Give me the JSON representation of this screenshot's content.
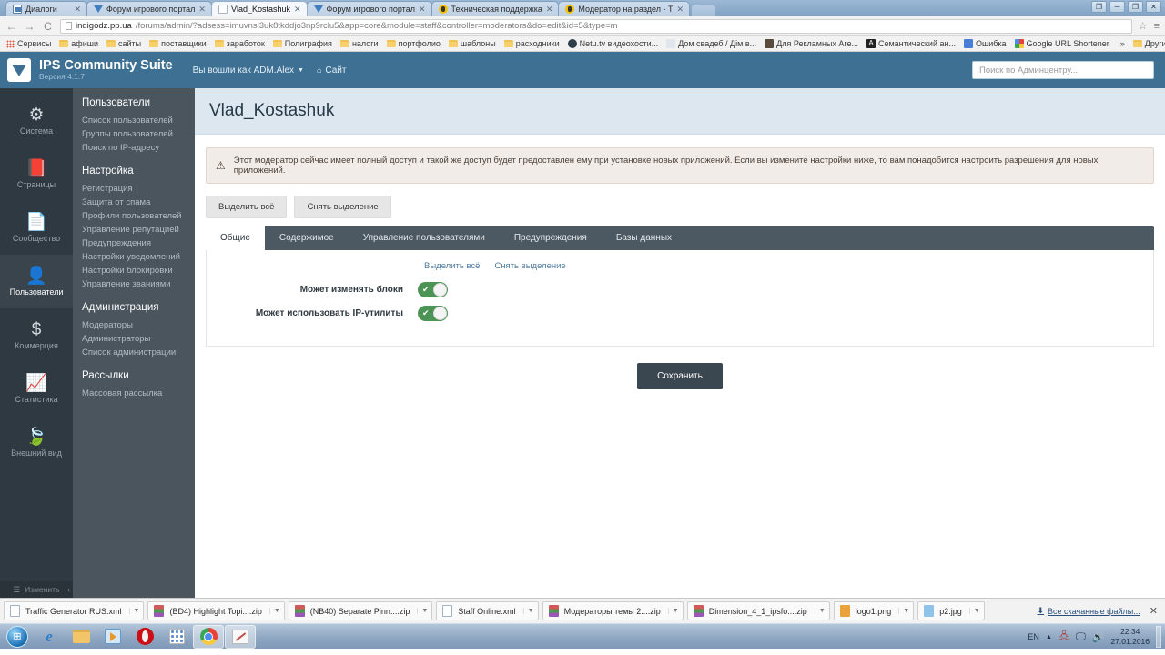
{
  "browser": {
    "tabs": [
      {
        "title": "Диалоги",
        "icon": "dialog-icon",
        "active": false
      },
      {
        "title": "Форум игрового портал",
        "icon": "forum-icon",
        "active": false
      },
      {
        "title": "Vlad_Kostashuk",
        "icon": "document-icon",
        "active": true
      },
      {
        "title": "Форум игрового портал",
        "icon": "forum-icon",
        "active": false
      },
      {
        "title": "Техническая поддержка",
        "icon": "support-icon",
        "active": false
      },
      {
        "title": "Модератор на раздел - Т",
        "icon": "support-icon",
        "active": false
      }
    ],
    "close_label": "✕",
    "window_buttons": [
      "❐",
      "─",
      "❐",
      "✕"
    ],
    "nav": {
      "back": "←",
      "forward": "→",
      "reload": "C",
      "star": "☆",
      "menu": "≡"
    },
    "url": {
      "host": "indigodz.pp.ua",
      "path": "/forums/admin/?adsess=imuvnsl3uk8tkddjo3np9rclu5&app=core&module=staff&controller=moderators&do=edit&id=5&type=m"
    },
    "bookmarks": [
      {
        "label": "Сервисы",
        "icon": "apps-grid-icon"
      },
      {
        "label": "афиши",
        "icon": "folder-icon"
      },
      {
        "label": "сайты",
        "icon": "folder-icon"
      },
      {
        "label": "поставщики",
        "icon": "folder-icon"
      },
      {
        "label": "заработок",
        "icon": "folder-icon"
      },
      {
        "label": "Полиграфия",
        "icon": "folder-icon"
      },
      {
        "label": "налоги",
        "icon": "folder-icon"
      },
      {
        "label": "портфолио",
        "icon": "folder-icon"
      },
      {
        "label": "шаблоны",
        "icon": "folder-icon"
      },
      {
        "label": "расходники",
        "icon": "folder-icon"
      },
      {
        "label": "Netu.tv видеохости...",
        "icon": "netu-icon"
      },
      {
        "label": "Дом свадеб / Дім в...",
        "icon": "site-icon"
      },
      {
        "label": "Для Рекламных Аге...",
        "icon": "agency-icon"
      },
      {
        "label": "Семантический ан...",
        "icon": "letter-a-icon"
      },
      {
        "label": "Ошибка",
        "icon": "error-icon"
      },
      {
        "label": "Google URL Shortener",
        "icon": "google-icon"
      }
    ],
    "bookmarks_overflow": "»",
    "other_bookmarks": "Другие закладки"
  },
  "ips": {
    "brand_name": "IPS Community Suite",
    "version": "Версия 4.1.7",
    "user_menu": "Вы вошли как ADM.Alex",
    "site_link": "Сайт",
    "search_placeholder": "Поиск по Админцентру...",
    "rail": [
      {
        "label": "Система",
        "icon": "gears-icon",
        "active": false
      },
      {
        "label": "Страницы",
        "icon": "book-icon",
        "active": false
      },
      {
        "label": "Сообщество",
        "icon": "document-icon",
        "active": false
      },
      {
        "label": "Пользователи",
        "icon": "user-icon",
        "active": true
      },
      {
        "label": "Коммерция",
        "icon": "dollar-icon",
        "active": false
      },
      {
        "label": "Статистика",
        "icon": "chart-icon",
        "active": false
      },
      {
        "label": "Внешний вид",
        "icon": "leaf-icon",
        "active": false
      }
    ],
    "rail_edit": "Изменить",
    "menu_groups": [
      {
        "heading": "Пользователи",
        "items": [
          "Список пользователей",
          "Группы пользователей",
          "Поиск по IP-адресу"
        ]
      },
      {
        "heading": "Настройка",
        "items": [
          "Регистрация",
          "Защита от спама",
          "Профили пользователей",
          "Управление репутацией",
          "Предупреждения",
          "Настройки уведомлений",
          "Настройки блокировки",
          "Управление званиями"
        ]
      },
      {
        "heading": "Администрация",
        "items": [
          "Модераторы",
          "Администраторы",
          "Список администрации"
        ]
      },
      {
        "heading": "Рассылки",
        "items": [
          "Массовая рассылка"
        ]
      }
    ]
  },
  "page": {
    "title": "Vlad_Kostashuk",
    "alert_icon": "warning-icon",
    "alert_text": "Этот модератор сейчас имеет полный доступ и такой же доступ будет предоставлен ему при установке новых приложений. Если вы измените настройки ниже, то вам понадобится настроить разрешения для новых приложений.",
    "top_buttons": [
      {
        "label": "Выделить всё"
      },
      {
        "label": "Снять выделение"
      }
    ],
    "tabs": [
      {
        "label": "Общие",
        "active": true
      },
      {
        "label": "Содержимое",
        "active": false
      },
      {
        "label": "Управление пользователями",
        "active": false
      },
      {
        "label": "Предупреждения",
        "active": false
      },
      {
        "label": "Базы данных",
        "active": false
      }
    ],
    "panel_links": [
      {
        "label": "Выделить всё"
      },
      {
        "label": "Снять выделение"
      }
    ],
    "fields": [
      {
        "label": "Может изменять блоки",
        "state": "on"
      },
      {
        "label": "Может использовать IP-утилиты",
        "state": "on"
      }
    ],
    "toggle_check": "✔",
    "save_label": "Сохранить",
    "accent_color": "#3d7093",
    "toggle_on_color": "#4c9455"
  },
  "downloads": {
    "items": [
      {
        "name": "Traffic Generator RUS.xml",
        "icon": "xml-file-icon"
      },
      {
        "name": "(BD4) Highlight Topi....zip",
        "icon": "zip-file-icon"
      },
      {
        "name": "(NB40) Separate Pinn....zip",
        "icon": "zip-file-icon"
      },
      {
        "name": "Staff Online.xml",
        "icon": "xml-file-icon"
      },
      {
        "name": "Модераторы темы 2....zip",
        "icon": "zip-file-icon"
      },
      {
        "name": "Dimension_4_1_ipsfo....zip",
        "icon": "zip-file-icon"
      },
      {
        "name": "logo1.png",
        "icon": "png-file-icon"
      },
      {
        "name": "p2.jpg",
        "icon": "jpg-file-icon"
      }
    ],
    "show_all": "Все скачанные файлы...",
    "close": "✕"
  },
  "taskbar": {
    "buttons": [
      {
        "icon": "windows-start-icon",
        "active": false
      },
      {
        "icon": "internet-explorer-icon",
        "active": false
      },
      {
        "icon": "explorer-folder-icon",
        "active": false
      },
      {
        "icon": "media-player-icon",
        "active": false
      },
      {
        "icon": "opera-icon",
        "active": false
      },
      {
        "icon": "apps-icon",
        "active": false
      },
      {
        "icon": "chrome-icon",
        "active": true
      },
      {
        "icon": "paint-icon",
        "active": true
      }
    ],
    "tray": {
      "language": "EN",
      "arrow": "▲",
      "network_icon": "network-error-icon",
      "display_icon": "display-icon",
      "volume_icon": "volume-icon",
      "time": "22:34",
      "date": "27.01.2016"
    }
  }
}
